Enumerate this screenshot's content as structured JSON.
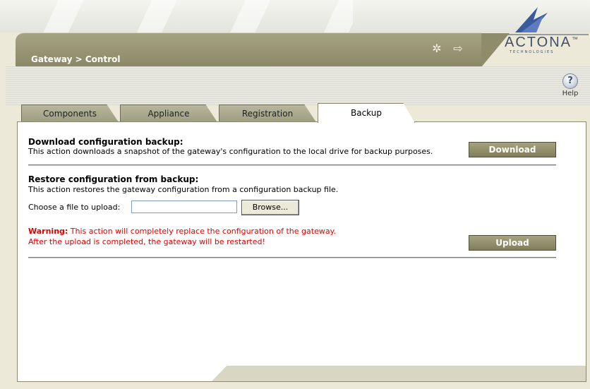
{
  "header": {
    "breadcrumb": "Gateway > Control",
    "icons": [
      "magic-wand-icon",
      "logout-icon"
    ]
  },
  "logo": {
    "text": "ACTONA",
    "tm": "™",
    "sub": "TECHNOLOGIES"
  },
  "help": {
    "label": "Help"
  },
  "tabs": [
    {
      "label": "Components",
      "active": false
    },
    {
      "label": "Appliance",
      "active": false
    },
    {
      "label": "Registration",
      "active": false
    },
    {
      "label": "Backup",
      "active": true
    }
  ],
  "download": {
    "title": "Download configuration backup:",
    "desc": "This action downloads a snapshot of the gateway's configuration to the local drive for backup purposes.",
    "button": "Download"
  },
  "restore": {
    "title": "Restore configuration from backup:",
    "desc": "This action restores the gateway configuration from a configuration backup file.",
    "file_label": "Choose a file to upload:",
    "file_value": "",
    "browse": "Browse...",
    "warning_label": "Warning:",
    "warning_line1": "This action will completely replace the configuration of the gateway.",
    "warning_line2": "After the upload is completed, the gateway will be restarted!",
    "button": "Upload"
  }
}
